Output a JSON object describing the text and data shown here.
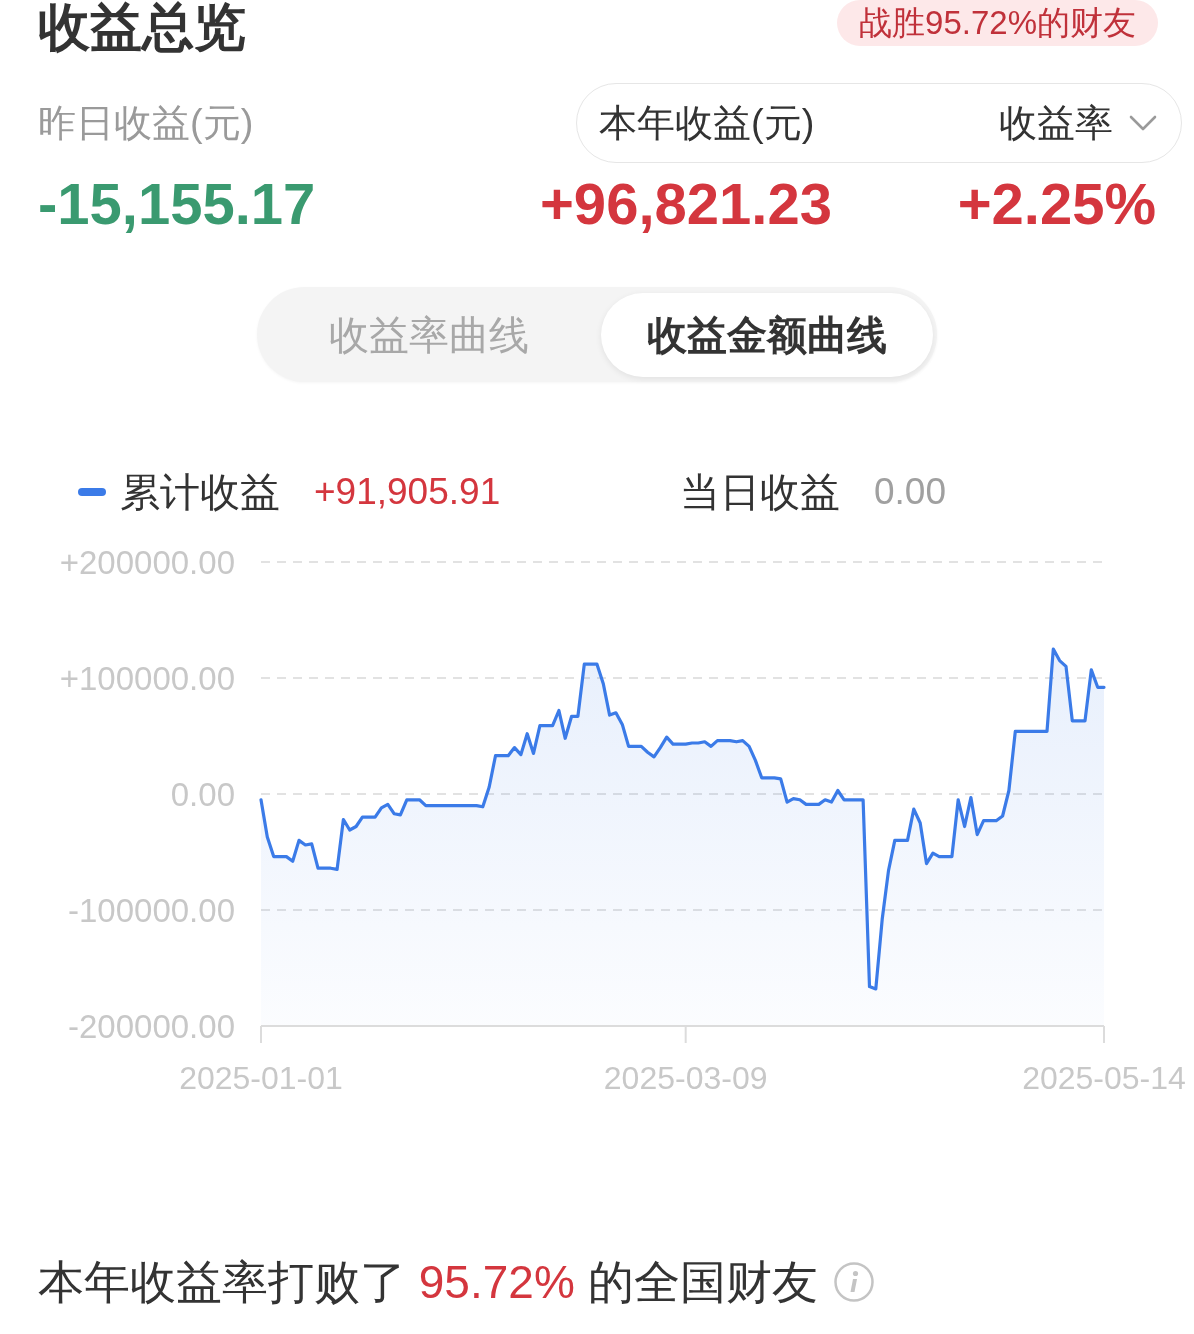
{
  "header": {
    "title": "收益总览",
    "badge": "战胜95.72%的财友"
  },
  "summary": {
    "yesterday": {
      "label": "昨日收益(元)",
      "value": "-15,155.17",
      "loss": true
    },
    "year": {
      "label": "本年收益(元)",
      "value": "+96,821.23",
      "loss": false
    },
    "rate": {
      "label": "收益率",
      "value": "+2.25%",
      "loss": false
    }
  },
  "curve_tabs": [
    {
      "label": "收益率曲线",
      "selected": false
    },
    {
      "label": "收益金额曲线",
      "selected": true
    }
  ],
  "chart": {
    "cumulative_value": {
      "text": "+91,905.91",
      "loss": false
    },
    "daily_label": "当日收益",
    "daily_value": "0.00",
    "chart_data": {
      "type": "line",
      "grid": true,
      "ylim": [
        -200000,
        200000
      ],
      "yticks": [
        {
          "value": 200000,
          "label": "+200000.00"
        },
        {
          "value": 100000,
          "label": "+100000.00"
        },
        {
          "value": 0,
          "label": "0.00"
        },
        {
          "value": -100000,
          "label": "-100000.00"
        },
        {
          "value": -200000,
          "label": "-200000.00"
        }
      ],
      "categories": [
        "2025-01-01",
        null,
        null,
        null,
        null,
        null,
        null,
        null,
        null,
        null,
        null,
        null,
        null,
        null,
        null,
        null,
        null,
        null,
        null,
        null,
        null,
        null,
        null,
        null,
        null,
        null,
        null,
        null,
        null,
        null,
        null,
        null,
        null,
        null,
        null,
        null,
        null,
        null,
        null,
        null,
        null,
        null,
        null,
        null,
        null,
        null,
        null,
        null,
        null,
        null,
        null,
        null,
        null,
        null,
        null,
        null,
        null,
        null,
        null,
        null,
        null,
        null,
        null,
        null,
        null,
        null,
        null,
        "2025-03-09",
        null,
        null,
        null,
        null,
        null,
        null,
        null,
        null,
        null,
        null,
        null,
        null,
        null,
        null,
        null,
        null,
        null,
        null,
        null,
        null,
        null,
        null,
        null,
        null,
        null,
        null,
        null,
        null,
        null,
        null,
        null,
        null,
        null,
        null,
        null,
        null,
        null,
        null,
        null,
        null,
        null,
        null,
        null,
        null,
        null,
        null,
        null,
        null,
        null,
        null,
        null,
        null,
        null,
        null,
        null,
        null,
        null,
        null,
        null,
        null,
        null,
        null,
        null,
        null,
        null,
        "2025-05-14"
      ],
      "series": [
        {
          "name": "累计收益",
          "color": "#3b7be8",
          "values": [
            -5000,
            -37000,
            -54000,
            -54000,
            -54000,
            -58000,
            -40000,
            -44000,
            -43000,
            -64000,
            -64000,
            -64000,
            -65000,
            -22000,
            -31000,
            -28000,
            -20000,
            -20000,
            -20000,
            -12000,
            -9000,
            -17000,
            -18000,
            -5000,
            -5000,
            -5000,
            -10000,
            -10000,
            -10000,
            -10000,
            -10000,
            -10000,
            -10000,
            -10000,
            -10000,
            -11000,
            6000,
            33000,
            33000,
            33000,
            40000,
            34000,
            52000,
            35000,
            59000,
            59000,
            59000,
            72000,
            48000,
            67000,
            67000,
            112000,
            112000,
            112000,
            95000,
            68000,
            70000,
            60000,
            41000,
            41000,
            41000,
            36000,
            32000,
            40000,
            49000,
            43000,
            43000,
            43000,
            44000,
            44000,
            45000,
            41000,
            46000,
            46000,
            46000,
            45000,
            46000,
            41000,
            29000,
            14000,
            14000,
            14000,
            13000,
            -7000,
            -4000,
            -5000,
            -9000,
            -9000,
            -9000,
            -5000,
            -7000,
            3000,
            -5000,
            -5000,
            -5000,
            -5000,
            -166000,
            -168000,
            -108000,
            -66000,
            -40000,
            -40000,
            -40000,
            -13000,
            -25000,
            -60000,
            -51000,
            -54000,
            -54000,
            -54000,
            -5000,
            -28000,
            -3000,
            -35000,
            -23000,
            -23000,
            -23000,
            -19000,
            3000,
            54000,
            54000,
            54000,
            54000,
            54000,
            54000,
            125000,
            115000,
            110000,
            63000,
            63000,
            63000,
            107000,
            92000,
            92000
          ]
        }
      ]
    }
  },
  "footer": {
    "prefix": "本年收益率打败了",
    "highlight": "95.72%",
    "suffix": "的全国财友"
  }
}
